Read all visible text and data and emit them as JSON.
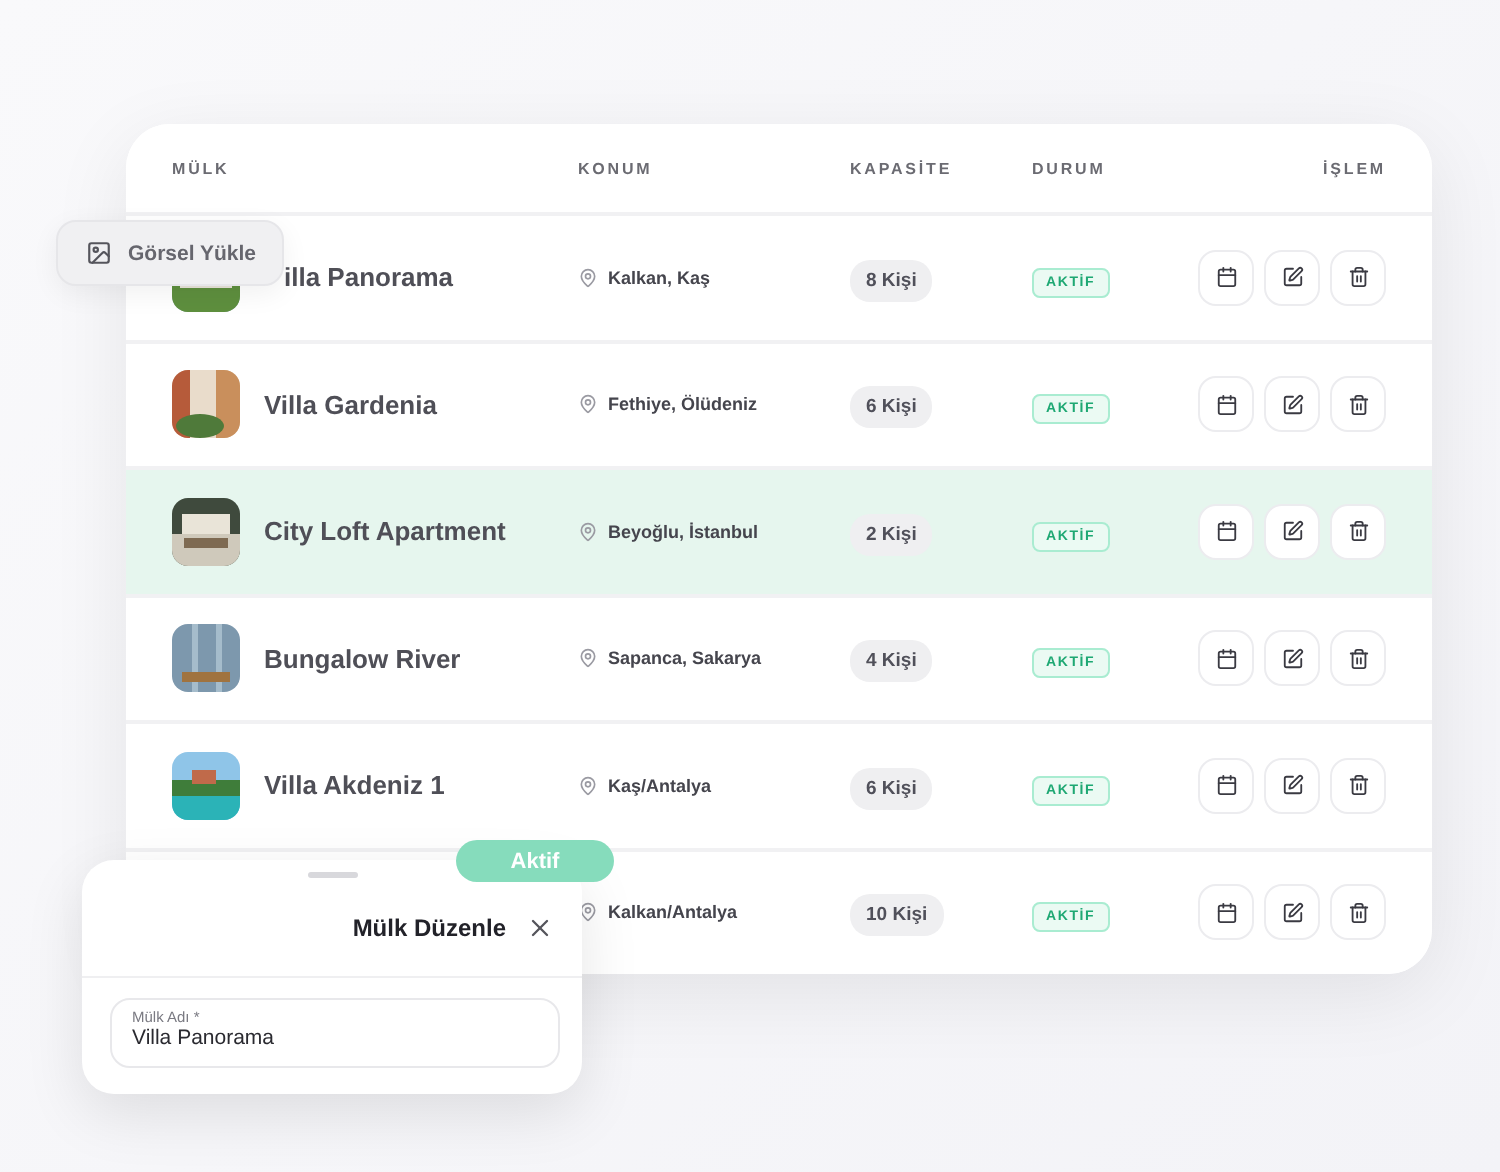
{
  "table": {
    "columns": [
      "MÜLK",
      "KONUM",
      "KAPASİTE",
      "DURUM",
      "İŞLEM"
    ],
    "rows": [
      {
        "name": "illa Panorama",
        "covered": true,
        "location": "Kalkan, Kaş",
        "capacity": "8 Kişi",
        "status": "AKTİF",
        "selected": false
      },
      {
        "name": "Villa Gardenia",
        "location": "Fethiye, Ölüdeniz",
        "capacity": "6 Kişi",
        "status": "AKTİF",
        "selected": false
      },
      {
        "name": "City Loft Apartment",
        "location": "Beyoğlu, İstanbul",
        "capacity": "2 Kişi",
        "status": "AKTİF",
        "selected": true
      },
      {
        "name": "Bungalow River",
        "location": "Sapanca, Sakarya",
        "capacity": "4 Kişi",
        "status": "AKTİF",
        "selected": false
      },
      {
        "name": "Villa Akdeniz 1",
        "location": "Kaş/Antalya",
        "capacity": "6 Kişi",
        "status": "AKTİF",
        "selected": false
      },
      {
        "location": "Kalkan/Antalya",
        "capacity": "10 Kişi",
        "status": "AKTİF",
        "selected": false
      }
    ]
  },
  "upload_chip": {
    "label": "Görsel Yükle"
  },
  "status_pill": {
    "label": "Aktif"
  },
  "edit_sheet": {
    "title": "Mülk Düzenle",
    "field": {
      "label": "Mülk Adı *",
      "value": "Villa Panorama"
    }
  }
}
